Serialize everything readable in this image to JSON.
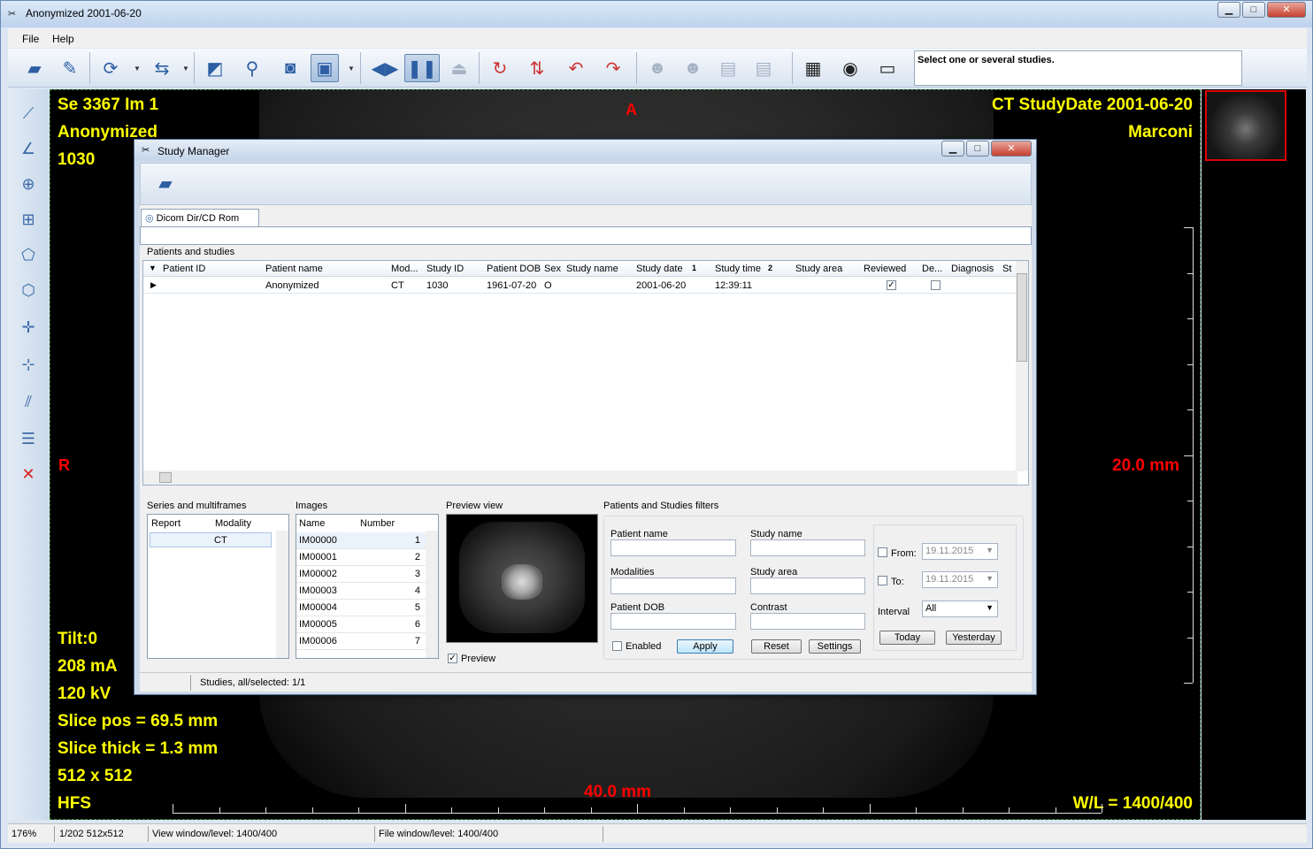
{
  "window": {
    "title": "Anonymized  2001-06-20",
    "minimize": "▁",
    "maximize": "□",
    "close": "✕"
  },
  "menu": [
    "File",
    "Help"
  ],
  "toolbar": {
    "status_message": "Select one or several studies."
  },
  "viewer": {
    "top_left": [
      "Se 3367 Im 1",
      " Anonymized",
      "1030"
    ],
    "top_right": [
      "CT StudyDate 2001-06-20",
      "Marconi"
    ],
    "bottom_left": [
      "Tilt:0",
      "208 mA",
      "120 kV",
      "Slice pos = 69.5 mm",
      "Slice thick = 1.3 mm",
      "512 x 512",
      " HFS"
    ],
    "bottom_right": "W/L = 1400/400",
    "orient_top": "A",
    "orient_left": "R",
    "scale_right": "20.0 mm",
    "scale_bottom": "40.0 mm"
  },
  "statusbar": {
    "zoom": "176%",
    "image": "1/202 512x512",
    "view_wl": "View window/level: 1400/400",
    "file_wl": "File window/level: 1400/400"
  },
  "study_manager": {
    "title": "Study Manager",
    "tab": "Dicom Dir/CD Rom",
    "patients_label": "Patients and studies",
    "columns": [
      "Patient ID",
      "Patient name",
      "Mod...",
      "Study ID",
      "Patient DOB",
      "Sex",
      "Study name",
      "Study date",
      "Study time",
      "Study area",
      "Reviewed",
      "De...",
      "Diagnosis",
      "St"
    ],
    "sort_markers": [
      "1",
      "2"
    ],
    "row": {
      "patient_id": "",
      "patient_name": "Anonymized",
      "modality": "CT",
      "study_id": "1030",
      "dob": "1961-07-20",
      "sex": "O",
      "study_name": "",
      "study_date": "2001-06-20",
      "study_time": "12:39:11",
      "study_area": "",
      "reviewed": true,
      "deleted": false
    },
    "series_label": "Series and multiframes",
    "series_columns": [
      "Report",
      "Modality"
    ],
    "series_rows": [
      {
        "report": "",
        "modality": "CT"
      }
    ],
    "images_label": "Images",
    "images_columns": [
      "Name",
      "Number"
    ],
    "images_rows": [
      {
        "name": "IM00000",
        "number": "1"
      },
      {
        "name": "IM00001",
        "number": "2"
      },
      {
        "name": "IM00002",
        "number": "3"
      },
      {
        "name": "IM00003",
        "number": "4"
      },
      {
        "name": "IM00004",
        "number": "5"
      },
      {
        "name": "IM00005",
        "number": "6"
      },
      {
        "name": "IM00006",
        "number": "7"
      }
    ],
    "preview_label": "Preview view",
    "preview_checkbox": "Preview",
    "filters_label": "Patients and Studies filters",
    "filter_patient_name": "Patient name",
    "filter_study_name": "Study name",
    "filter_modalities": "Modalities",
    "filter_study_area": "Study area",
    "filter_dob": "Patient DOB",
    "filter_contrast": "Contrast",
    "enabled": "Enabled",
    "apply": "Apply",
    "reset": "Reset",
    "settings": "Settings",
    "from_label": "From:",
    "from_value": "19.11.2015",
    "to_label": "To:",
    "to_value": "19.11.2015",
    "interval_label": "Interval",
    "interval_value": "All",
    "today": "Today",
    "yesterday": "Yesterday",
    "status": "Studies, all/selected: 1/1"
  }
}
